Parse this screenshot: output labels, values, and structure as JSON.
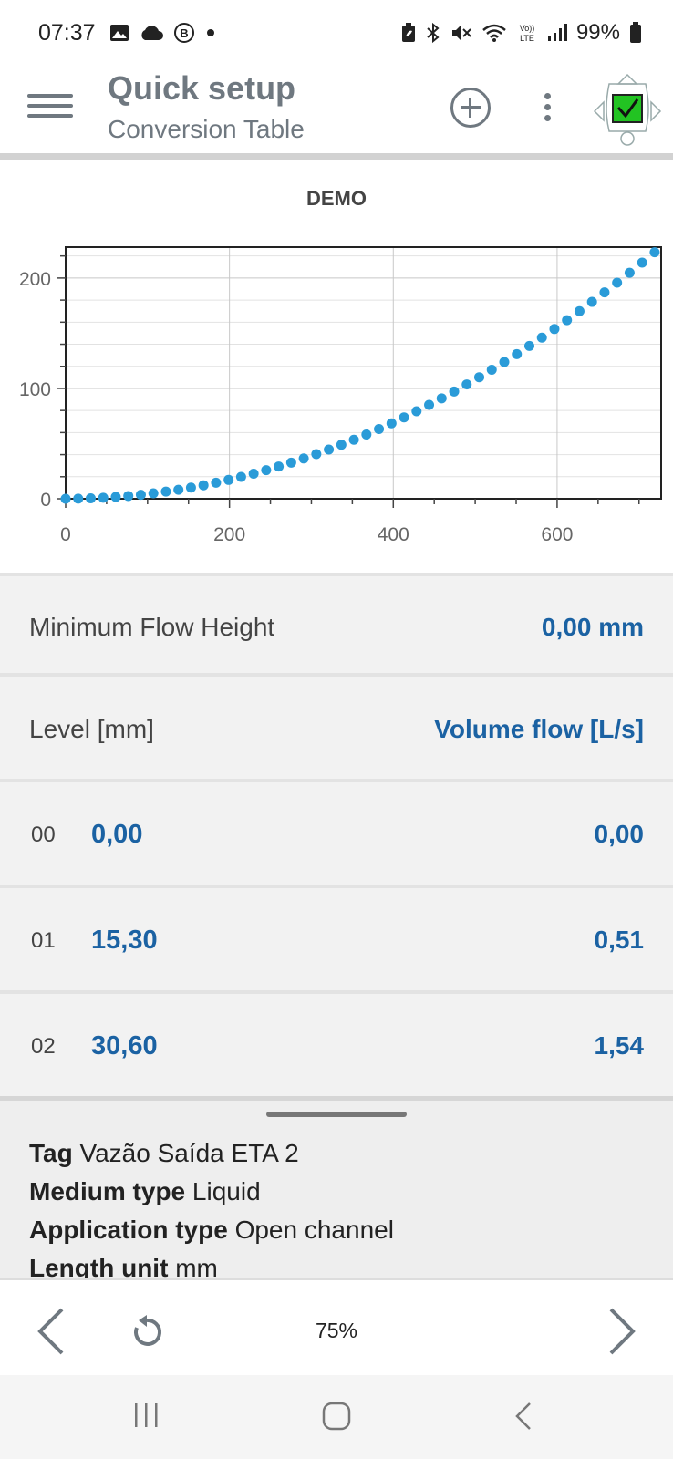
{
  "status_bar": {
    "time": "07:37",
    "battery": "99%",
    "left_icons": [
      "gallery-icon",
      "cloud-icon",
      "b-badge-icon",
      "dot-icon"
    ],
    "right_icons": [
      "battery-saver-icon",
      "bluetooth-icon",
      "mute-icon",
      "wifi-icon",
      "volte-icon",
      "signal-icon",
      "battery-icon"
    ]
  },
  "app_bar": {
    "title": "Quick setup",
    "subtitle": "Conversion Table",
    "status_color": "#22c322"
  },
  "chart_data": {
    "type": "scatter",
    "title": "DEMO",
    "xlabel": "",
    "ylabel": "",
    "xlim": [
      0,
      727
    ],
    "ylim": [
      0,
      228
    ],
    "xticks": [
      0,
      200,
      400,
      600
    ],
    "yticks": [
      0,
      100,
      200
    ],
    "grid": true,
    "series_color": "#2a9bd8",
    "x_step": 15.3,
    "count": 48,
    "k": 0.000432
  },
  "min_flow": {
    "label": "Minimum Flow Height",
    "value": "0,00 mm"
  },
  "table": {
    "headers": {
      "level": "Level [mm]",
      "flow": "Volume flow [L/s]"
    },
    "rows": [
      {
        "index": "00",
        "level": "0,00",
        "flow": "0,00"
      },
      {
        "index": "01",
        "level": "15,30",
        "flow": "0,51"
      },
      {
        "index": "02",
        "level": "30,60",
        "flow": "1,54"
      }
    ]
  },
  "info": {
    "tag_label": "Tag",
    "tag_value": "Vazão Saída ETA 2",
    "medium_label": "Medium type",
    "medium_value": "Liquid",
    "application_label": "Application type",
    "application_value": "Open channel",
    "length_label": "Length unit",
    "length_value": "mm"
  },
  "bottom_bar": {
    "progress": "75%"
  }
}
